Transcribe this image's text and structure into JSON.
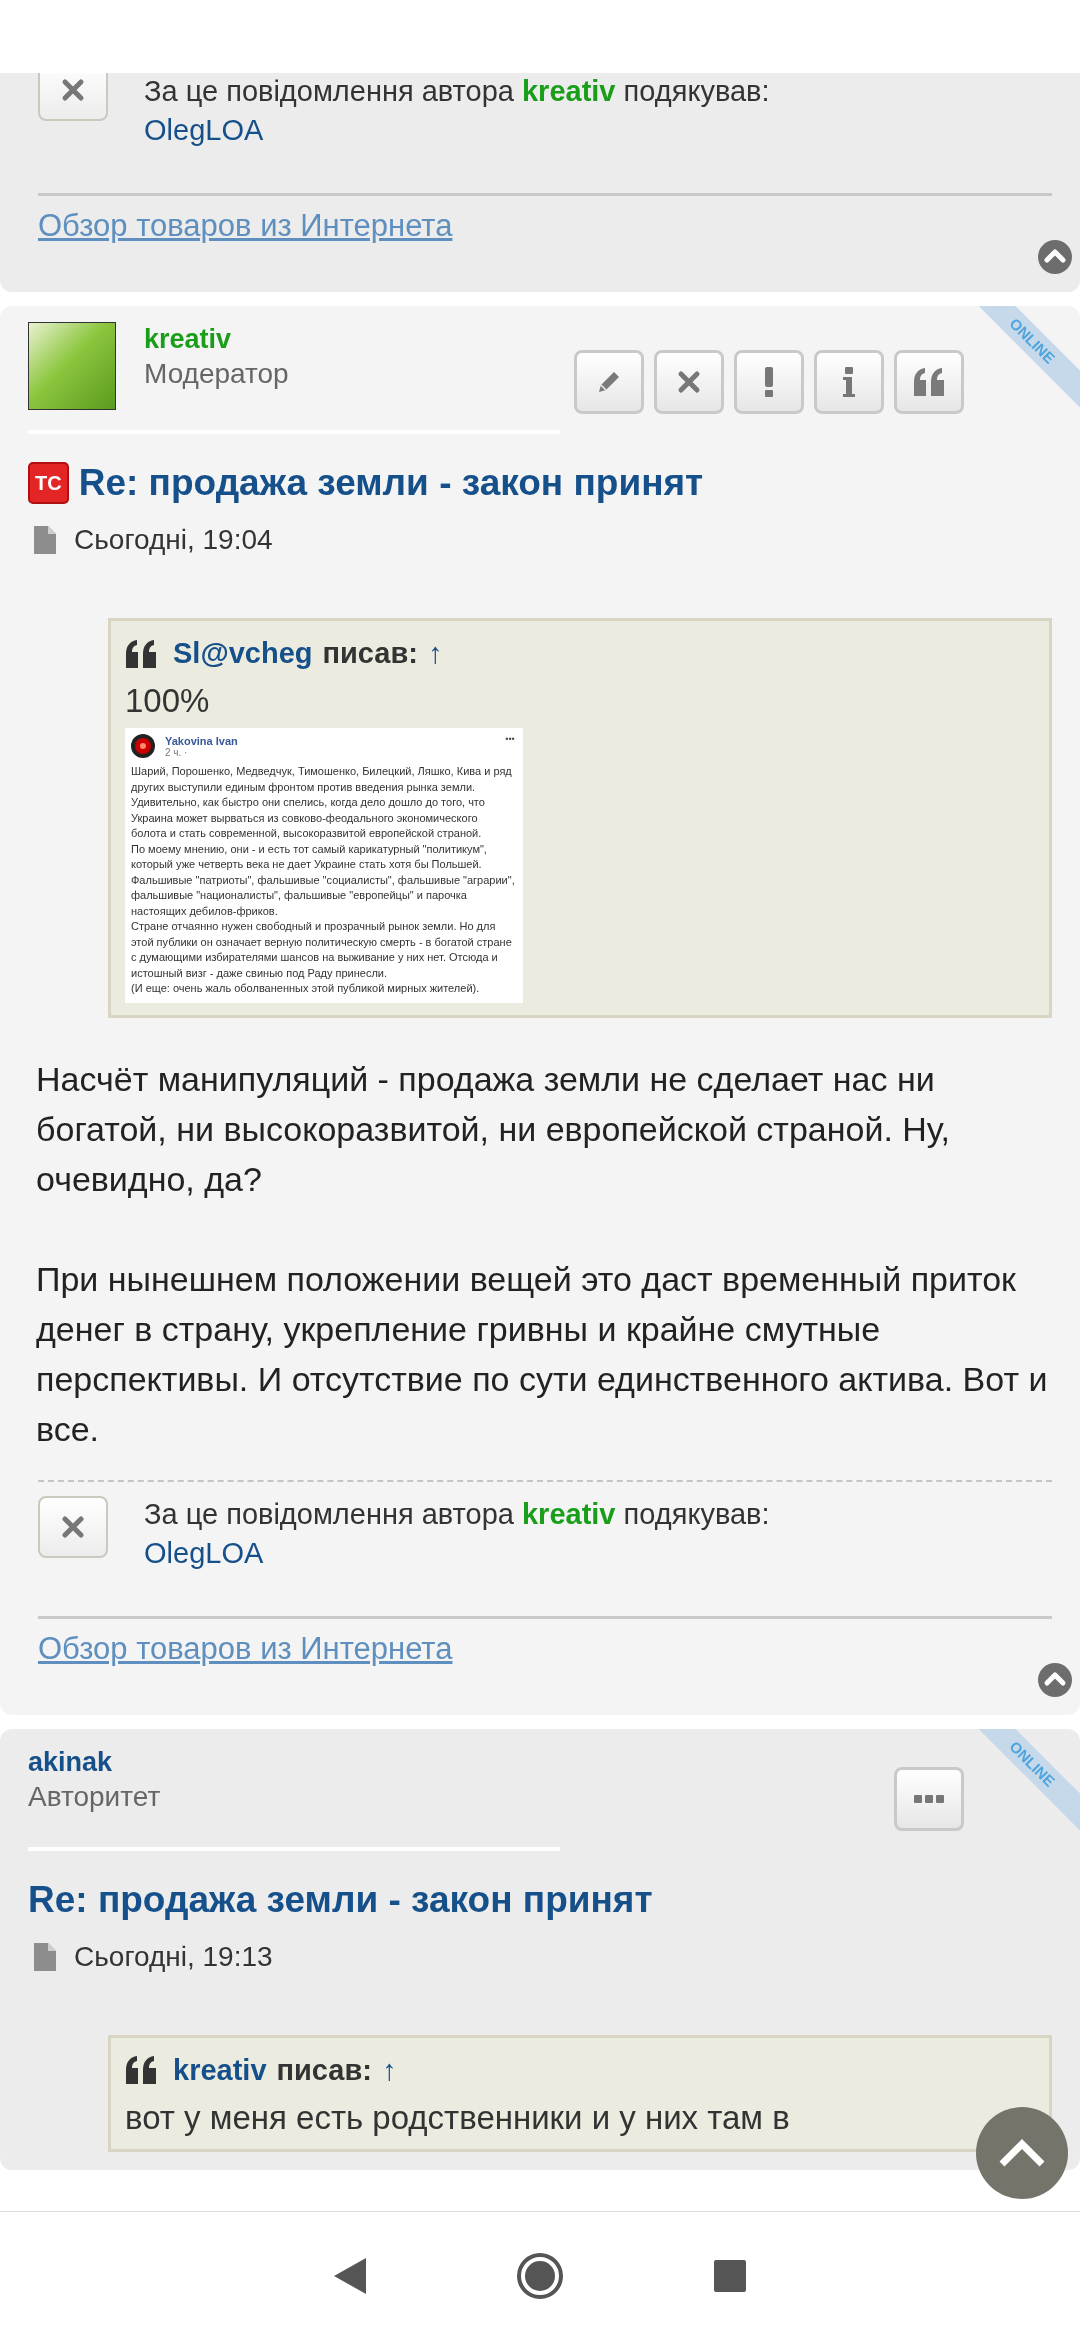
{
  "top_post": {
    "thanks": {
      "prefix": "За це повідомлення автора",
      "author": "kreativ",
      "color": "#1a9e1a",
      "suffix": "подякував:",
      "users": [
        "OlegLOA"
      ]
    },
    "link": "Обзор товаров из Интернета"
  },
  "posts": [
    {
      "author": "kreativ",
      "color": "#1a9e1a",
      "rank": "Модератор",
      "avatar": true,
      "online": "ONLINE",
      "actions": [
        {
          "kind": "edit"
        },
        {
          "kind": "delete"
        },
        {
          "kind": "report"
        },
        {
          "kind": "info"
        },
        {
          "kind": "quote"
        }
      ],
      "topic_starter": true,
      "badge": "TC",
      "title": "Re: продажа земли - закон принят",
      "date": "Сьогодні, 19:04",
      "quote": {
        "author": "Sl@vcheg",
        "wrote": "писав:",
        "arrow": "↑",
        "text": [
          "100%"
        ],
        "screenshot": {
          "name": "Yakovina Ivan",
          "time": "2 ч. ·",
          "menu": "•••",
          "lines": [
            "Шарий, Порошенко, Медведчук, Тимошенко, Билецкий, Ляшко, Кива и ряд",
            "других выступили единым фронтом против введения рынка земли.",
            "Удивительно, как быстро они спелись, когда дело дошло до того, что",
            "Украина может вырваться из совково-феодального экономического",
            "болота и стать современной, высокоразвитой европейской страной.",
            "По моему мнению, они - и есть тот самый карикатурный \"политикум\",",
            "который уже четверть века не дает Украине стать хотя бы Польшей.",
            "Фальшивые \"патриоты\", фальшивые \"социалисты\", фальшивые \"аграрии\",",
            "фальшивые \"националисты\", фальшивые \"европейцы\" и парочка",
            "настоящих дебилов-фриков.",
            "Стране отчаянно нужен свободный и прозрачный рынок земли. Но для",
            "этой публики он означает верную политическую смерть - в богатой стране",
            "с думающими избирателями шансов на выживание у них нет. Отсюда и",
            "истошный визг - даже свинью под Раду принесли.",
            "(И еще: очень жаль оболваненных этой публикой мирных жителей)."
          ]
        }
      },
      "body": [
        "Насчёт манипуляций - продажа земли не сделает нас ни богатой, ни высокоразвитой, ни европейской страной. Ну, очевидно, да?",
        "При нынешнем положении вещей это даст временный приток денег в страну, укрепление гривны и крайне смутные перспективы. И отсутствие по сути единственного актива. Вот и все."
      ],
      "thanks": {
        "prefix": "За це повідомлення автора",
        "author": "kreativ",
        "color": "#1a9e1a",
        "suffix": "подякував:",
        "users": [
          "OlegLOA"
        ]
      },
      "link": "Обзор товаров из Интернета"
    },
    {
      "author": "akinak",
      "color": "#16508a",
      "rank": "Авторитет",
      "avatar": false,
      "online": "ONLINE",
      "actions": [
        {
          "kind": "more"
        }
      ],
      "topic_starter": false,
      "title": "Re: продажа земли - закон принят",
      "date": "Сьогодні, 19:13",
      "quote": {
        "author": "kreativ",
        "wrote": "писав:",
        "arrow": "↑",
        "text": [
          "вот у меня есть родственники и у них там в"
        ]
      }
    }
  ]
}
